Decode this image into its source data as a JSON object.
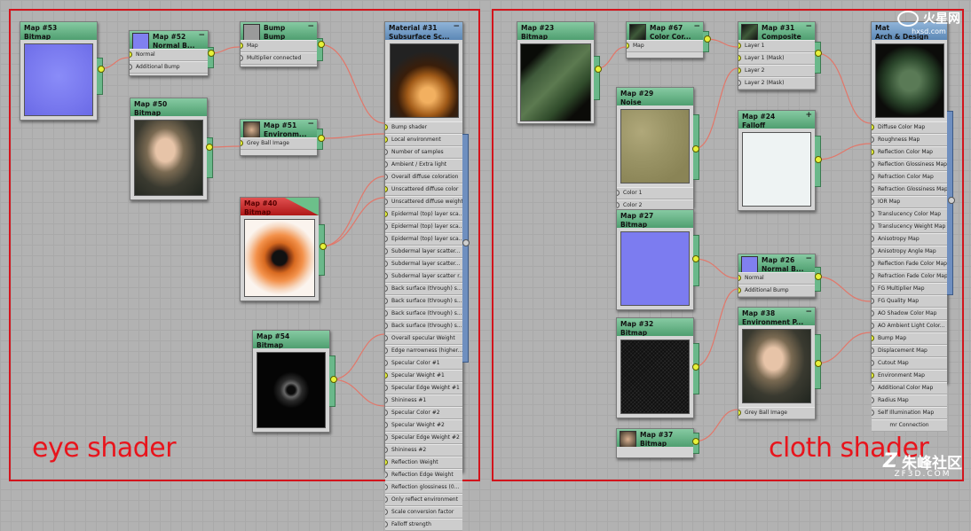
{
  "labels": {
    "left_panel": "eye shader",
    "right_panel": "cloth shader"
  },
  "watermark": {
    "top_right_cn": "火星网",
    "top_right_url": "hxsd.com",
    "bottom_right_cn": "朱峰社区",
    "bottom_right_url": "ZF3D.COM"
  },
  "eye": {
    "map53": {
      "num": "Map #53",
      "type": "Bitmap"
    },
    "map52": {
      "num": "Map #52",
      "type": "Normal B...",
      "slots": [
        "Normal",
        "Additional Bump"
      ]
    },
    "bump": {
      "num": "Bump",
      "type": "Bump",
      "slots": [
        "Map",
        "Multiplier connected"
      ]
    },
    "map50": {
      "num": "Map #50",
      "type": "Bitmap"
    },
    "map51": {
      "num": "Map #51",
      "type": "Environm...",
      "slots": [
        "Grey Ball Image"
      ]
    },
    "map40": {
      "num": "Map #40",
      "type": "Bitmap"
    },
    "map54": {
      "num": "Map #54",
      "type": "Bitmap"
    },
    "material31": {
      "num": "Material #31",
      "type": "Subsurface Sc...",
      "slots": [
        "Bump shader",
        "Local environment",
        "Number of samples",
        "Ambient / Extra light",
        "Overall diffuse coloration",
        "Unscattered diffuse color",
        "Unscattered diffuse weight",
        "Epidermal (top) layer sca...",
        "Epidermal (top) layer sca...",
        "Epidermal (top) layer sca...",
        "Subdermal layer scatter...",
        "Subdermal layer scatter...",
        "Subdermal layer scatter r...",
        "Back surface (through) s...",
        "Back surface (through) s...",
        "Back surface (through) s...",
        "Back surface (through) s...",
        "Overall specular Weight",
        "Edge narrowness (higher...",
        "Specular Color #1",
        "Specular Weight #1",
        "Specular Edge Weight #1",
        "Shininess #1",
        "Specular Color #2",
        "Specular Weight #2",
        "Specular Edge Weight #2",
        "Shininess #2",
        "Reflection Weight",
        "Reflection Edge Weight",
        "Reflection glossiness (0...",
        "Only reflect environment",
        "Scale conversion factor",
        "Falloff strength"
      ]
    }
  },
  "cloth": {
    "map23": {
      "num": "Map #23",
      "type": "Bitmap"
    },
    "map67": {
      "num": "Map #67",
      "type": "Color Cor...",
      "slots": [
        "Map"
      ]
    },
    "map31": {
      "num": "Map #31",
      "type": "Composite",
      "slots": [
        "Layer 1",
        "Layer 1 (Mask)",
        "Layer 2",
        "Layer 2 (Mask)"
      ]
    },
    "map29": {
      "num": "Map #29",
      "type": "Noise",
      "slots": [
        "Color 1",
        "Color 2"
      ]
    },
    "map24": {
      "num": "Map #24",
      "type": "Falloff"
    },
    "map27": {
      "num": "Map #27",
      "type": "Bitmap"
    },
    "map26": {
      "num": "Map #26",
      "type": "Normal B...",
      "slots": [
        "Normal",
        "Additional Bump"
      ]
    },
    "map32": {
      "num": "Map #32",
      "type": "Bitmap"
    },
    "map38": {
      "num": "Map #38",
      "type": "Environment P...",
      "slots": [
        "Grey Ball Image"
      ]
    },
    "map37": {
      "num": "Map #37",
      "type": "Bitmap"
    },
    "material": {
      "num": "Mat",
      "type": "Arch & Design",
      "slots": [
        "Diffuse Color Map",
        "Roughness Map",
        "Reflection Color Map",
        "Reflection Glossiness Map",
        "Refraction Color Map",
        "Refraction Glossiness Map",
        "IOR Map",
        "Translucency Color Map",
        "Translucency Weight Map",
        "Anisotropy Map",
        "Anisotropy Angle Map",
        "Reflection Fade Color Map",
        "Refraction Fade Color Map",
        "FG Multiplier Map",
        "FG Quality Map",
        "AO Shadow Color Map",
        "AO Ambient Light Color...",
        "Bump Map",
        "Displacement Map",
        "Cutout Map",
        "Environment Map",
        "Additional Color Map",
        "Radius Map",
        "Self Illumination Map"
      ],
      "footer": "mr Connection"
    }
  }
}
